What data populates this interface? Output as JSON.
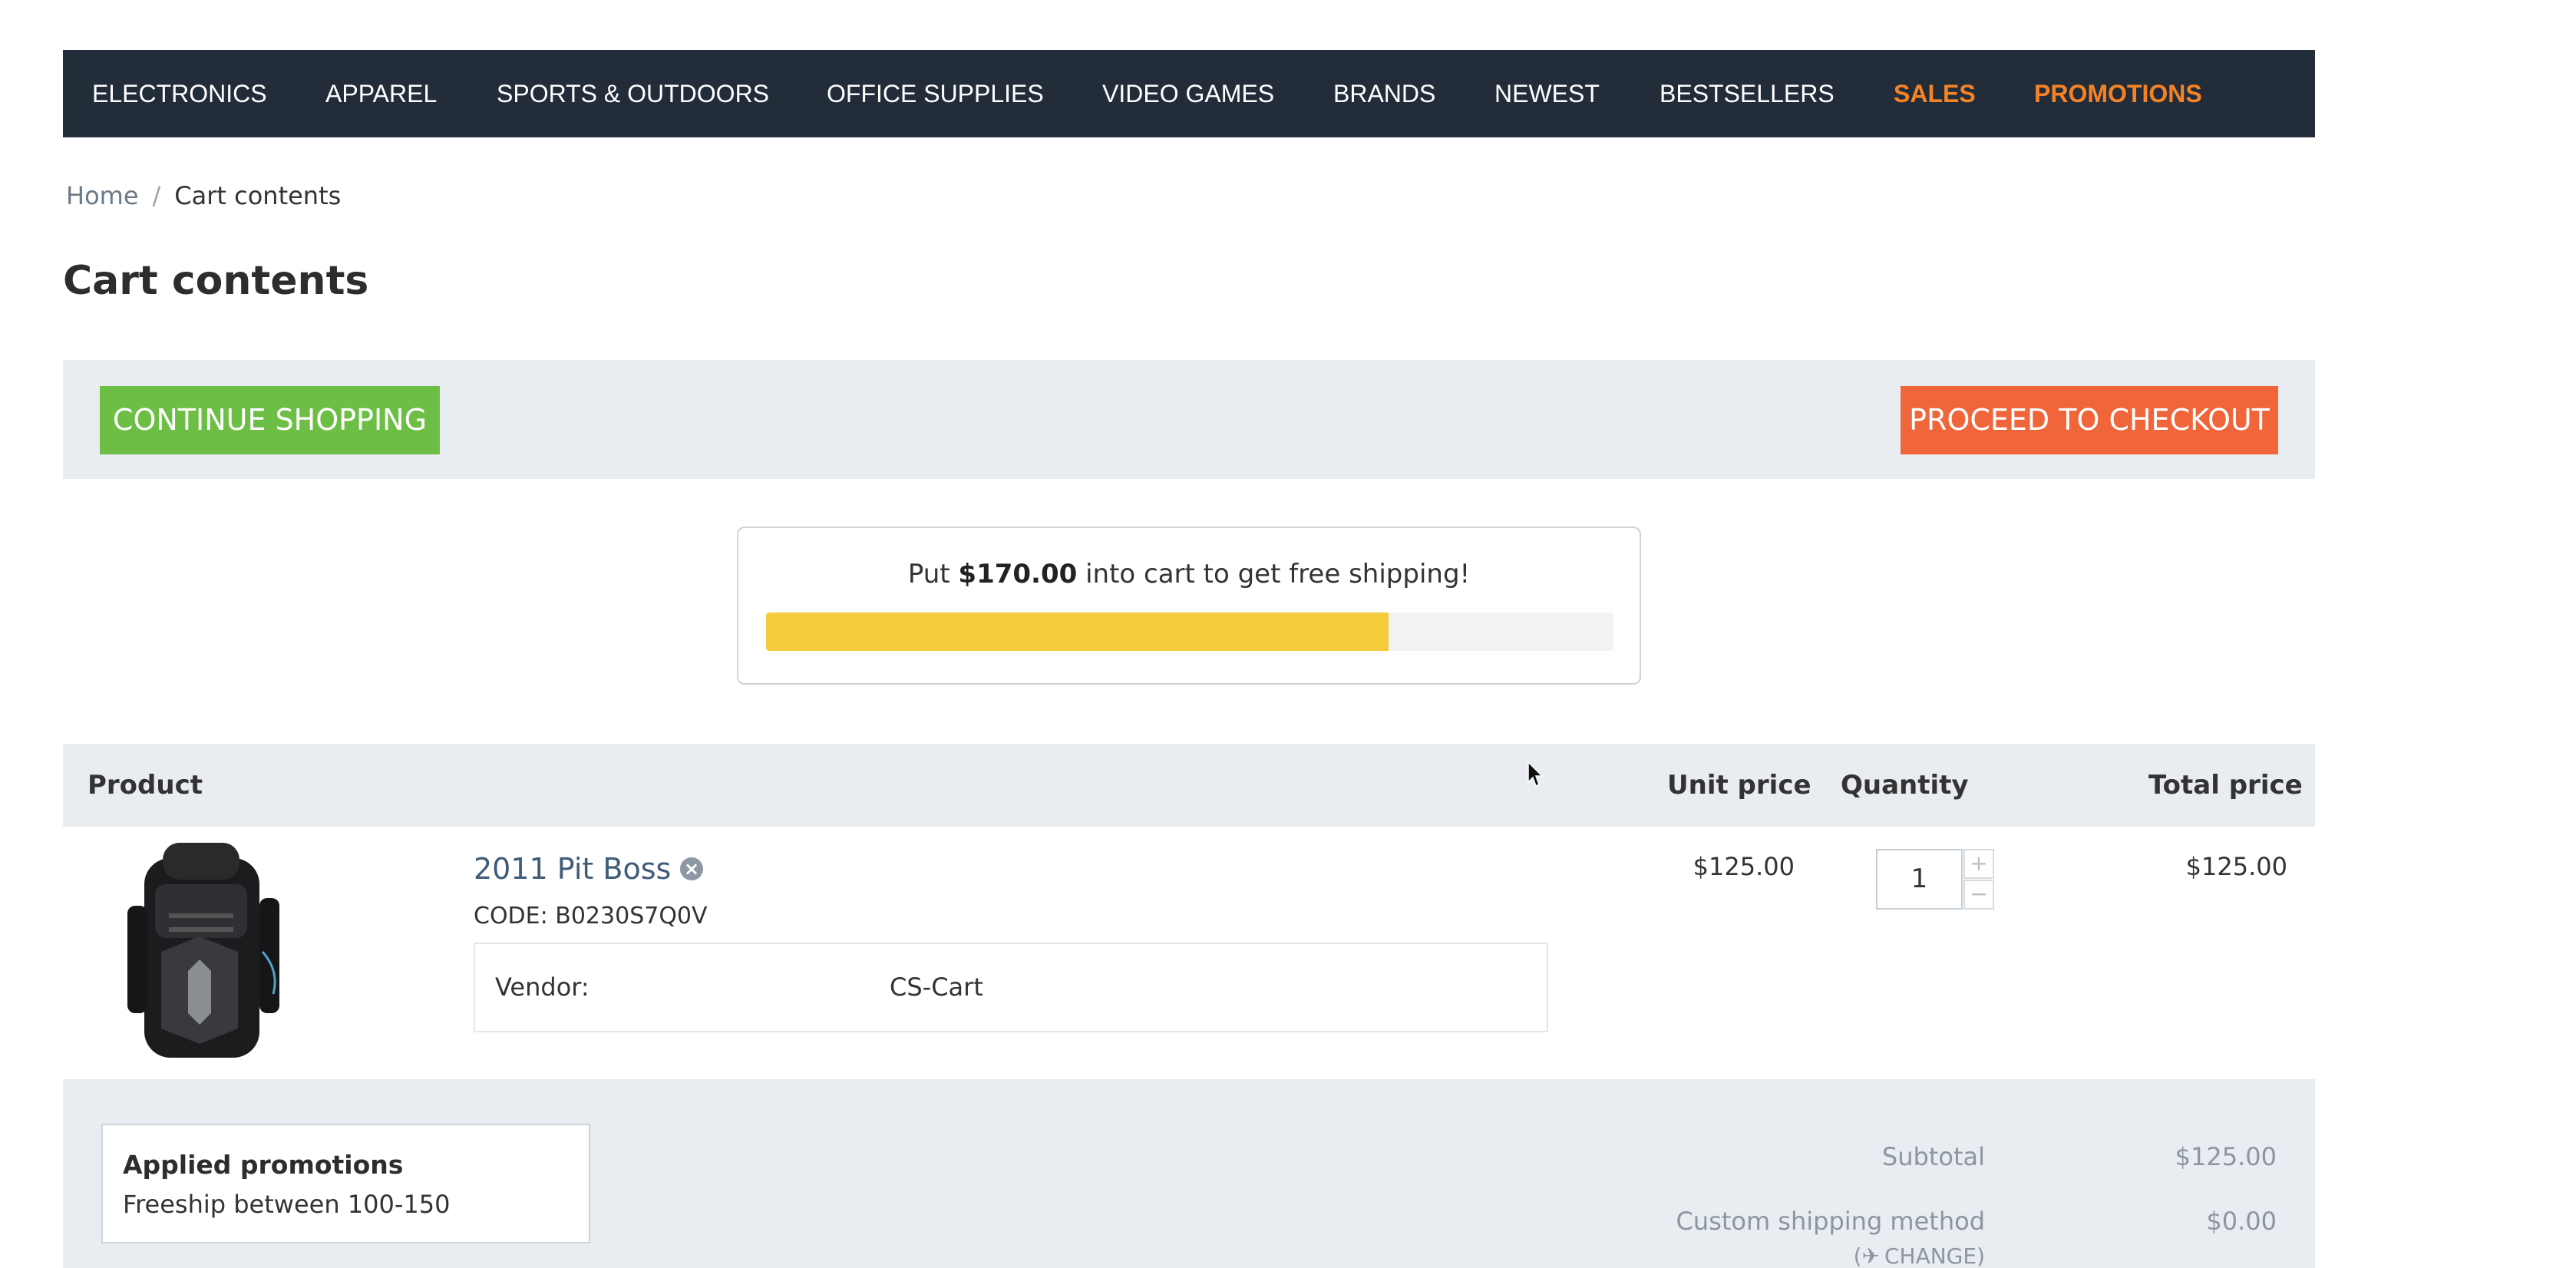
{
  "nav": {
    "items": [
      {
        "label": "ELECTRONICS"
      },
      {
        "label": "APPAREL"
      },
      {
        "label": "SPORTS & OUTDOORS"
      },
      {
        "label": "OFFICE SUPPLIES"
      },
      {
        "label": "VIDEO GAMES"
      },
      {
        "label": "BRANDS"
      },
      {
        "label": "NEWEST"
      },
      {
        "label": "BESTSELLERS"
      },
      {
        "label": "SALES"
      },
      {
        "label": "PROMOTIONS"
      }
    ]
  },
  "breadcrumb": {
    "home": "Home",
    "separator": "/",
    "current": "Cart contents"
  },
  "page_title": "Cart contents",
  "actions": {
    "continue_label": "CONTINUE SHOPPING",
    "checkout_label": "PROCEED TO CHECKOUT"
  },
  "free_shipping": {
    "text_before": "Put ",
    "amount": "$170.00",
    "text_after": " into cart to get free shipping!",
    "progress_fraction": 0.735
  },
  "table": {
    "headers": {
      "product": "Product",
      "unit_price": "Unit price",
      "quantity": "Quantity",
      "total_price": "Total price"
    }
  },
  "cart_item": {
    "name": "2011 Pit Boss",
    "code": "CODE: B0230S7Q0V",
    "vendor_label": "Vendor:",
    "vendor_value": "CS-Cart",
    "unit_price": "$125.00",
    "quantity": "1",
    "total_price": "$125.00",
    "remove_icon": "close-circle-icon",
    "plus": "+",
    "minus": "−"
  },
  "promotions": {
    "title": "Applied promotions",
    "items": [
      "Freeship between 100-150"
    ]
  },
  "summary": {
    "subtotal_label": "Subtotal",
    "subtotal_value": "$125.00",
    "shipping_label": "Custom shipping method",
    "shipping_value": "$0.00",
    "change_prefix": "(",
    "change_label": "CHANGE",
    "change_suffix": ")"
  },
  "colors": {
    "nav_bg": "#222d39",
    "nav_promo": "#f58325",
    "continue_btn": "#6cbf44",
    "checkout_btn": "#f0653a",
    "progress_fill": "#f6cc3f",
    "panel_bg": "#e9ecf0",
    "link": "#3f5c78"
  }
}
